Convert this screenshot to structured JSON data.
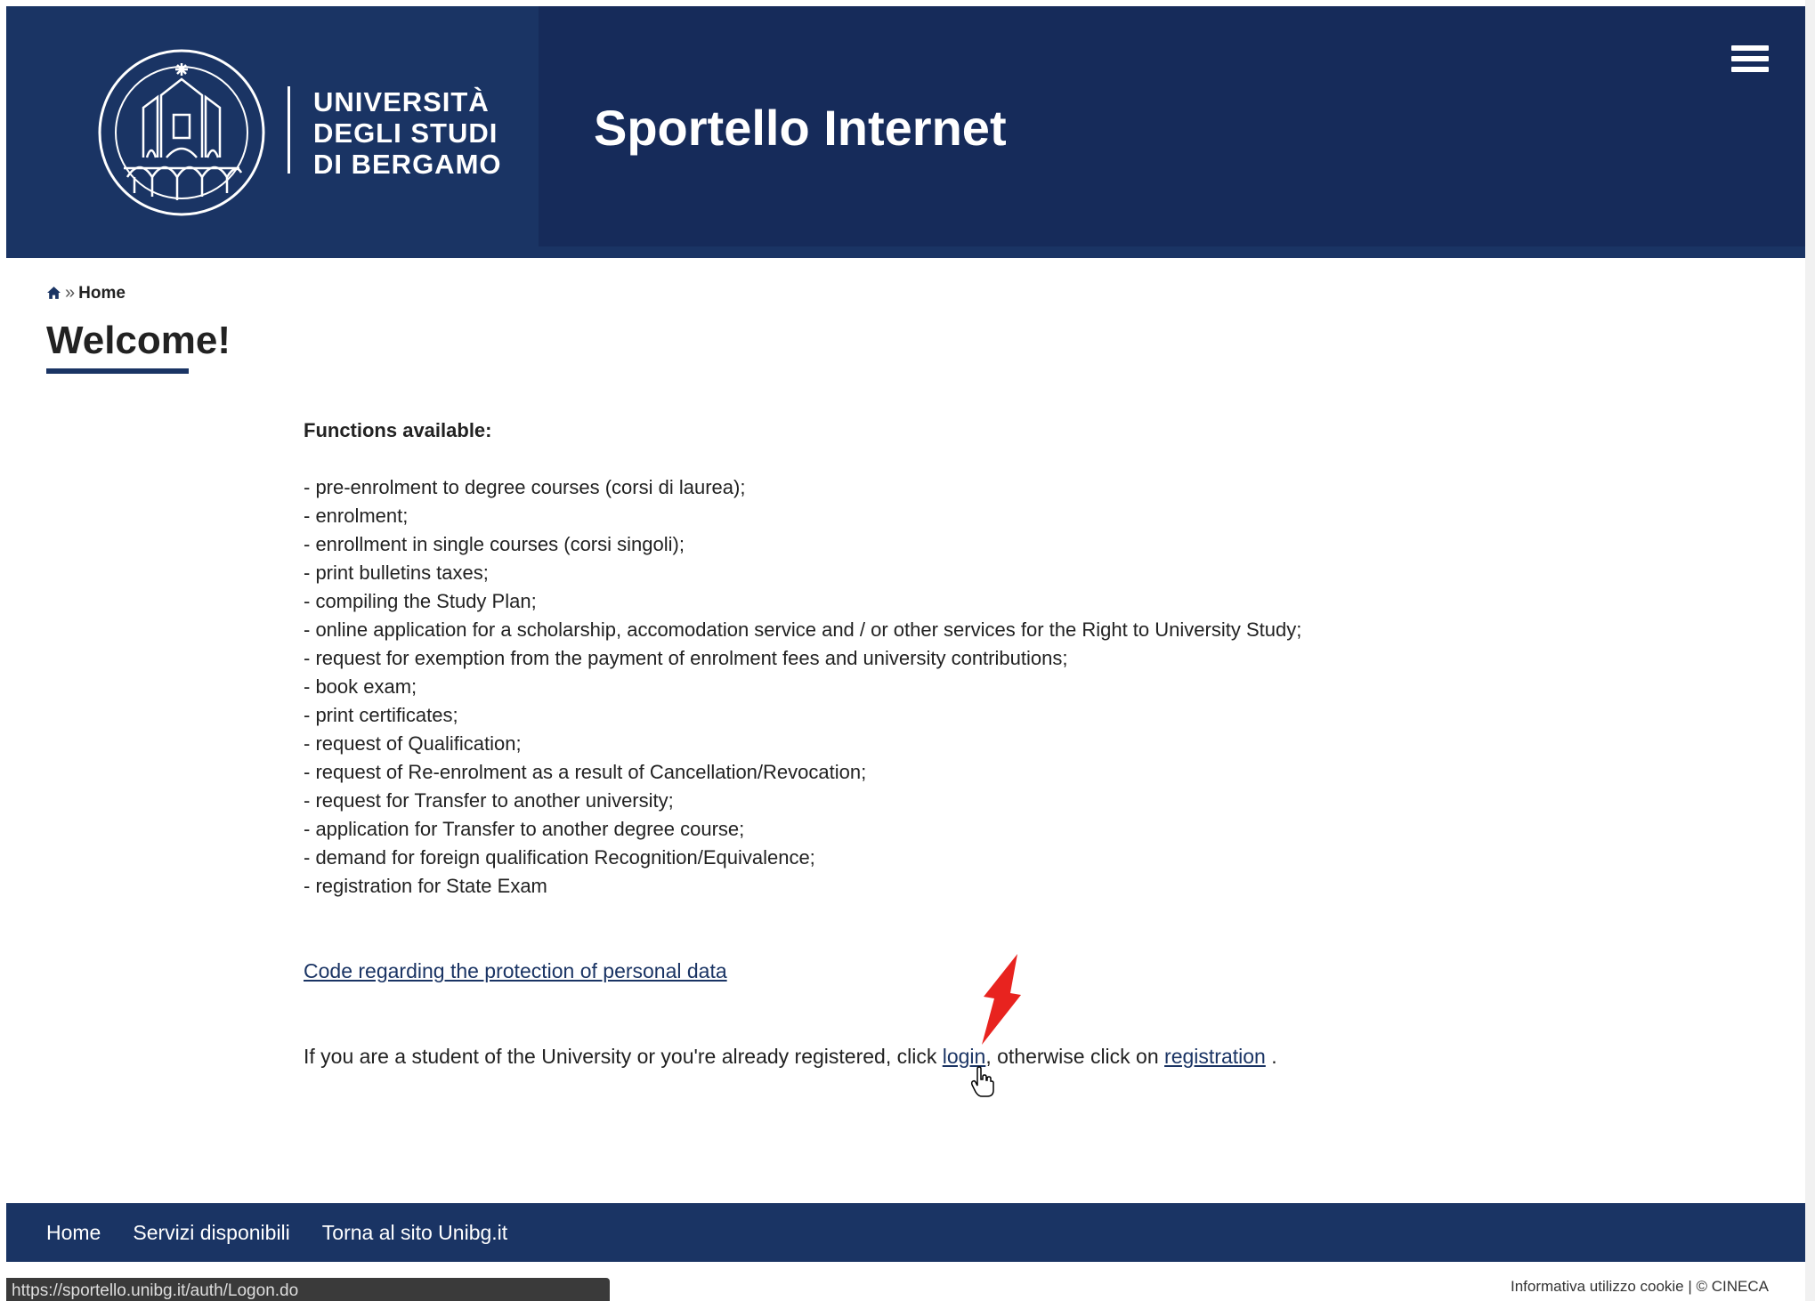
{
  "header": {
    "university_name_line1": "UNIVERSITÀ",
    "university_name_line2": "DEGLI STUDI",
    "university_name_line3": "DI BERGAMO",
    "portal_title": "Sportello Internet",
    "menu_icon": "hamburger-menu-icon"
  },
  "breadcrumb": {
    "home_icon": "home-icon",
    "separator": "»",
    "current": "Home"
  },
  "main": {
    "title": "Welcome!",
    "functions_heading": "Functions available:",
    "functions": [
      "- pre-enrolment to degree courses (corsi di laurea);",
      "- enrolment;",
      "- enrollment in single courses (corsi singoli);",
      "- print bulletins taxes;",
      "- compiling the Study Plan;",
      "- online application for a scholarship, accomodation service and / or other services for the Right to University Study;",
      "- request for exemption from the payment of enrolment fees and university contributions;",
      "- book exam;",
      "- print certificates;",
      "- request of Qualification;",
      "- request of Re-enrolment as a result of Cancellation/Revocation;",
      "- request for Transfer to another university;",
      "- application for Transfer to another degree course;",
      "- demand for foreign qualification Recognition/Equivalence;",
      "- registration for State Exam"
    ],
    "privacy_link": "Code regarding the protection of personal data ",
    "login_text_before": "If you are a student of the University or you're already registered, click ",
    "login_link": "login",
    "login_text_middle": ", otherwise click on ",
    "registration_link": "registration",
    "login_text_after": " ."
  },
  "footer": {
    "nav": [
      "Home",
      "Servizi disponibili",
      "Torna al sito Unibg.it"
    ],
    "cookie_link": "Informativa utilizzo cookie",
    "cookie_separator": " | ",
    "copyright": "© CINECA"
  },
  "status_bar": {
    "url": "https://sportello.unibg.it/auth/Logon.do"
  },
  "colors": {
    "header_bg": "#1a3464",
    "header_right_bg": "#162b5a",
    "link": "#1a3464",
    "annotation_arrow": "#e8231f"
  }
}
